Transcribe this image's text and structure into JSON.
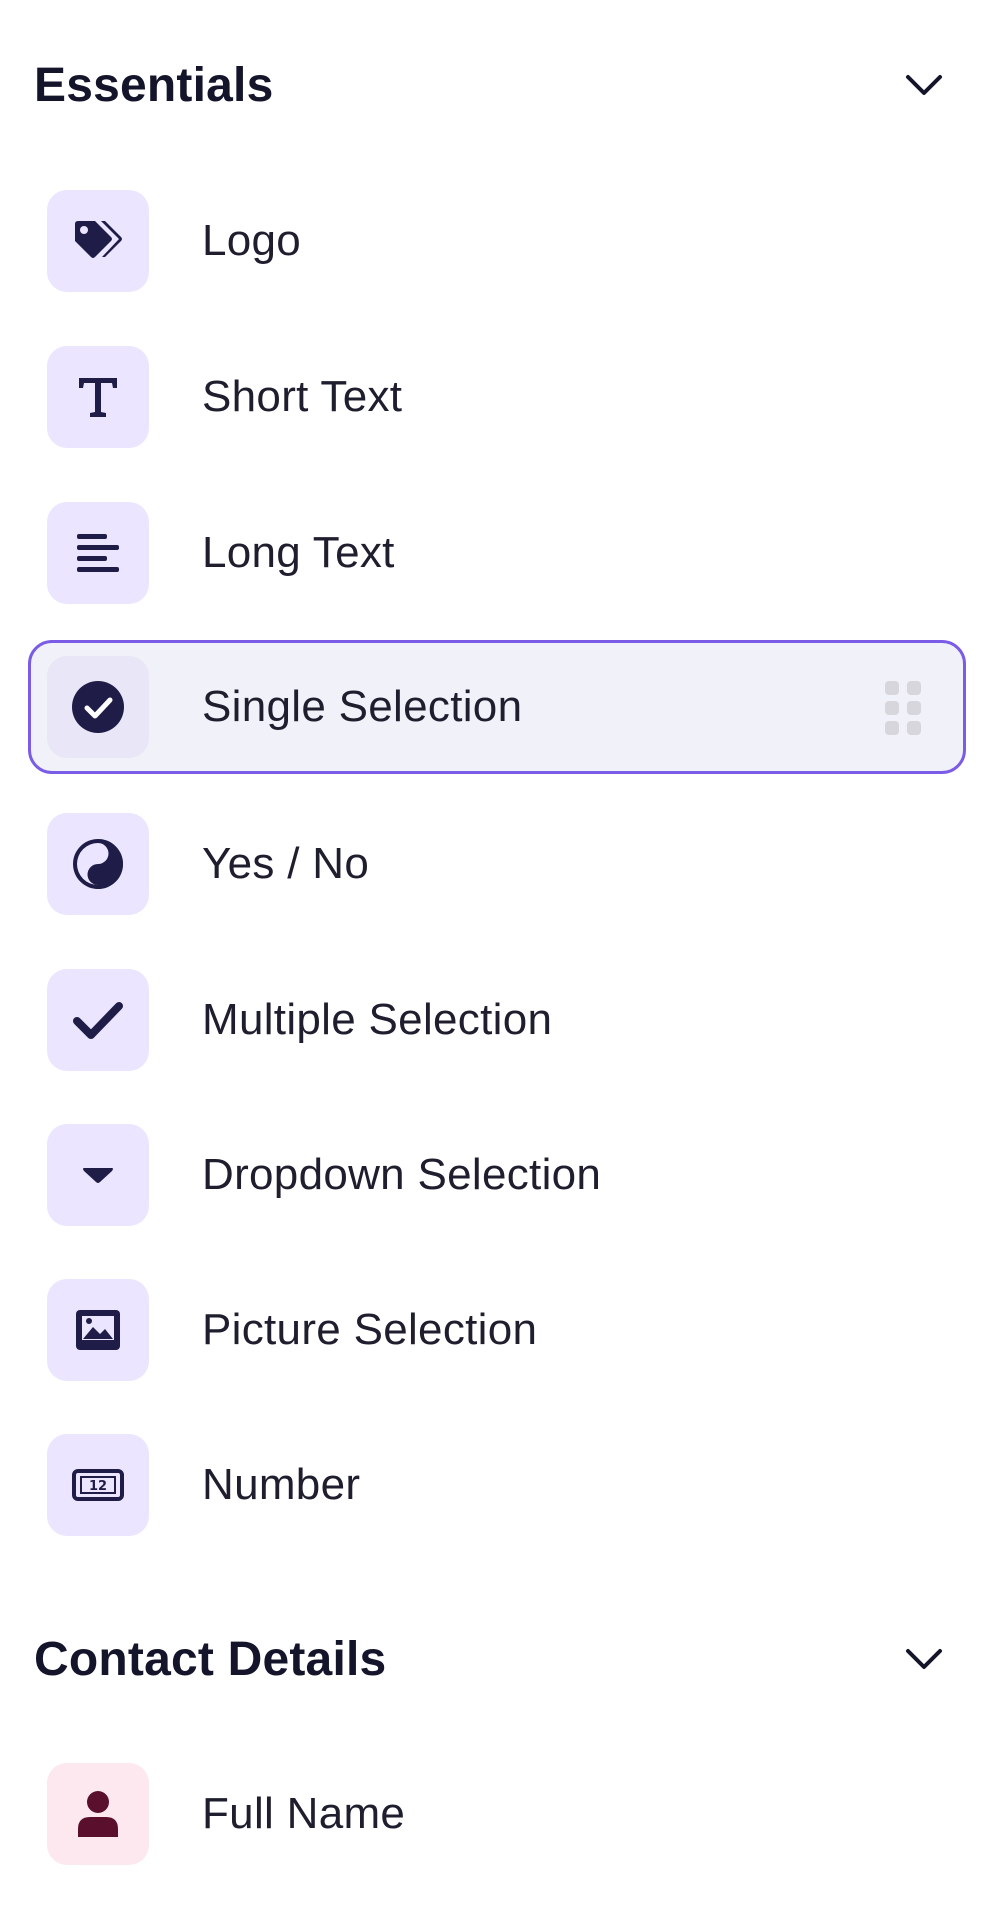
{
  "colors": {
    "icon_bg": "#ebe5ff",
    "icon_bg_contact": "#fde8ef",
    "icon_fg": "#1f1d47",
    "icon_fg_contact": "#5a0f2c",
    "selected_border": "#7a5ce6",
    "selected_bg": "#f0f1f9"
  },
  "sections": {
    "essentials": {
      "title": "Essentials",
      "toggle_icon": "chevron-down-icon",
      "items": [
        {
          "label": "Logo",
          "icon": "tag-icon"
        },
        {
          "label": "Short Text",
          "icon": "text-t-icon"
        },
        {
          "label": "Long Text",
          "icon": "align-left-icon"
        },
        {
          "label": "Single Selection",
          "icon": "check-circle-icon",
          "selected": true,
          "handle_icon": "drag-handle-icon"
        },
        {
          "label": "Yes / No",
          "icon": "yin-yang-icon"
        },
        {
          "label": "Multiple Selection",
          "icon": "checkmark-icon"
        },
        {
          "label": "Dropdown Selection",
          "icon": "caret-down-icon"
        },
        {
          "label": "Picture Selection",
          "icon": "image-icon"
        },
        {
          "label": "Number",
          "icon": "number-field-icon"
        }
      ]
    },
    "contact": {
      "title": "Contact Details",
      "toggle_icon": "chevron-down-icon",
      "items": [
        {
          "label": "Full Name",
          "icon": "user-icon"
        }
      ]
    }
  }
}
